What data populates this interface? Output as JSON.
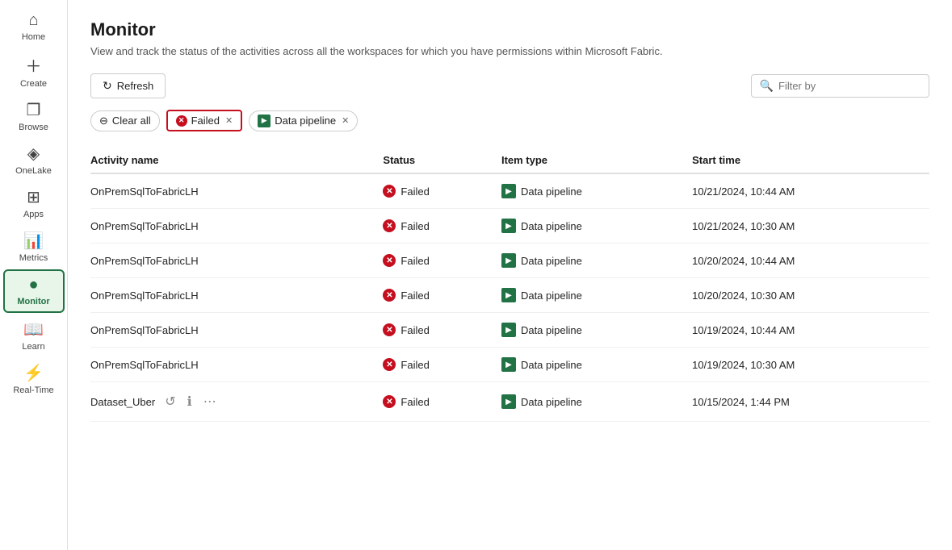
{
  "sidebar": {
    "items": [
      {
        "id": "home",
        "label": "Home",
        "icon": "⌂",
        "active": false
      },
      {
        "id": "create",
        "label": "Create",
        "icon": "⊕",
        "active": false
      },
      {
        "id": "browse",
        "label": "Browse",
        "icon": "▣",
        "active": false
      },
      {
        "id": "onelake",
        "label": "OneLake",
        "icon": "◈",
        "active": false
      },
      {
        "id": "apps",
        "label": "Apps",
        "icon": "⊞",
        "active": false
      },
      {
        "id": "metrics",
        "label": "Metrics",
        "icon": "⊿",
        "active": false
      },
      {
        "id": "monitor",
        "label": "Monitor",
        "icon": "●",
        "active": true
      },
      {
        "id": "learn",
        "label": "Learn",
        "icon": "⊟",
        "active": false
      },
      {
        "id": "realtime",
        "label": "Real-Time",
        "icon": "⚡",
        "active": false
      }
    ]
  },
  "header": {
    "title": "Monitor",
    "subtitle": "View and track the status of the activities across all the workspaces for which you have permissions within Microsoft Fabric."
  },
  "toolbar": {
    "refresh_label": "Refresh"
  },
  "filter_bar": {
    "clear_all_label": "Clear all",
    "failed_chip_label": "Failed",
    "pipeline_chip_label": "Data pipeline",
    "filter_placeholder": "Filter by"
  },
  "table": {
    "columns": [
      "Activity name",
      "Status",
      "Item type",
      "Start time"
    ],
    "rows": [
      {
        "name": "OnPremSqlToFabricLH",
        "status": "Failed",
        "item_type": "Data pipeline",
        "start_time": "10/21/2024, 10:44 AM",
        "show_actions": false
      },
      {
        "name": "OnPremSqlToFabricLH",
        "status": "Failed",
        "item_type": "Data pipeline",
        "start_time": "10/21/2024, 10:30 AM",
        "show_actions": false
      },
      {
        "name": "OnPremSqlToFabricLH",
        "status": "Failed",
        "item_type": "Data pipeline",
        "start_time": "10/20/2024, 10:44 AM",
        "show_actions": false
      },
      {
        "name": "OnPremSqlToFabricLH",
        "status": "Failed",
        "item_type": "Data pipeline",
        "start_time": "10/20/2024, 10:30 AM",
        "show_actions": false
      },
      {
        "name": "OnPremSqlToFabricLH",
        "status": "Failed",
        "item_type": "Data pipeline",
        "start_time": "10/19/2024, 10:44 AM",
        "show_actions": false
      },
      {
        "name": "OnPremSqlToFabricLH",
        "status": "Failed",
        "item_type": "Data pipeline",
        "start_time": "10/19/2024, 10:30 AM",
        "show_actions": false
      },
      {
        "name": "Dataset_Uber",
        "status": "Failed",
        "item_type": "Data pipeline",
        "start_time": "10/15/2024, 1:44 PM",
        "show_actions": true
      }
    ]
  },
  "colors": {
    "failed_red": "#c50f1f",
    "pipeline_green": "#217346",
    "active_sidebar": "#217346"
  }
}
